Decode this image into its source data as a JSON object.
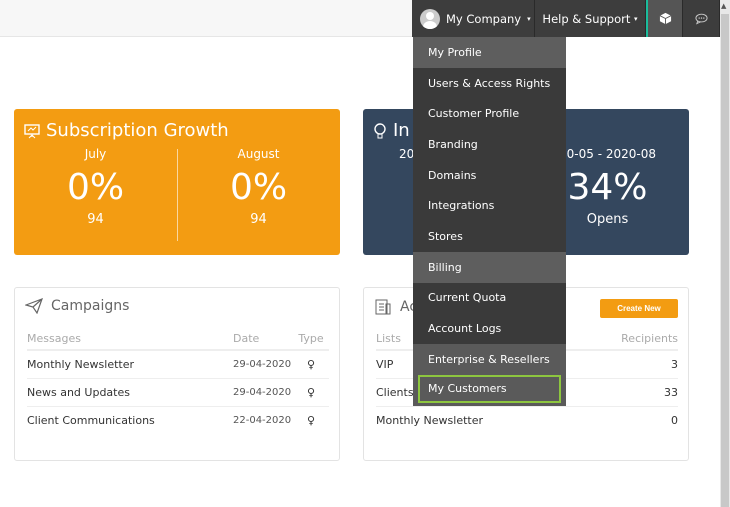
{
  "nav": {
    "company": "My Company",
    "company_caret": "▾",
    "help": "Help & Support",
    "help_caret": "▾",
    "box_icon": "cube-icon",
    "chat_icon": "chat-icon"
  },
  "menu": {
    "items": [
      {
        "label": "My Profile",
        "state": "highlighted"
      },
      {
        "label": "Users & Access Rights"
      },
      {
        "label": "Customer Profile"
      },
      {
        "label": "Branding"
      },
      {
        "label": "Domains"
      },
      {
        "label": "Integrations"
      },
      {
        "label": "Stores"
      },
      {
        "label": "Billing",
        "state": "highlighted"
      },
      {
        "label": "Current Quota"
      },
      {
        "label": "Account Logs"
      },
      {
        "label": "Enterprise & Resellers",
        "state": "highlighted"
      },
      {
        "label": "My Customers",
        "state": "selected"
      }
    ]
  },
  "subscription": {
    "title": "Subscription Growth",
    "color": "#f39c12",
    "cols": [
      {
        "label": "July",
        "value": "0%",
        "count": "94"
      },
      {
        "label": "August",
        "value": "0%",
        "count": "94"
      }
    ]
  },
  "interactions": {
    "title": "In",
    "color": "#34475e",
    "cols": [
      {
        "label": "20"
      },
      {
        "label": "20-05 - 2020-08",
        "value": "34%",
        "count": "Opens"
      }
    ]
  },
  "campaigns": {
    "title": "Campaigns",
    "headers": [
      "Messages",
      "Date",
      "Type"
    ],
    "rows": [
      {
        "name": "Monthly Newsletter",
        "date": "29-04-2020"
      },
      {
        "name": "News and Updates",
        "date": "29-04-2020"
      },
      {
        "name": "Client Communications",
        "date": "22-04-2020"
      }
    ]
  },
  "lists": {
    "title": "Ac",
    "create": "Create New",
    "headers": [
      "Lists",
      "Recipients"
    ],
    "rows": [
      {
        "name": "VIP",
        "count": "3"
      },
      {
        "name": "Clients",
        "count": "33"
      },
      {
        "name": "Monthly Newsletter",
        "count": "0"
      }
    ]
  }
}
